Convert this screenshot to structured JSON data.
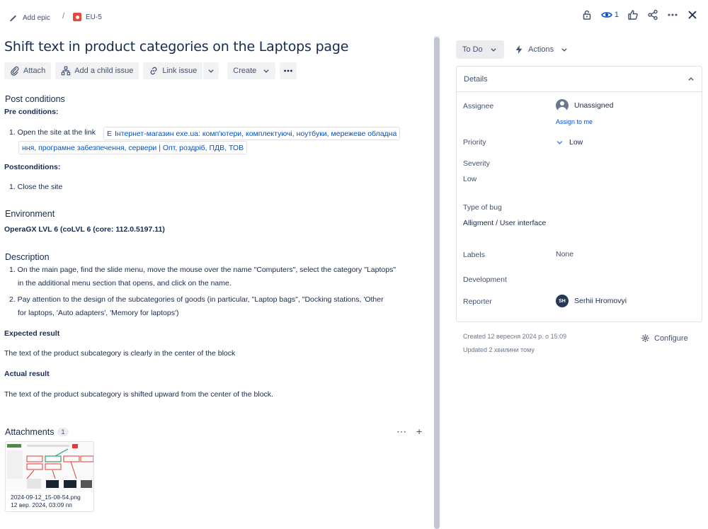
{
  "breadcrumb": {
    "epic_label": "Add epic",
    "separator": "/",
    "issue_key": "EU-5"
  },
  "top_actions": {
    "watch_count": "1"
  },
  "issue": {
    "title": "Shift text in product categories on the Laptops page",
    "toolbar": {
      "attach": "Attach",
      "child": "Add a child issue",
      "link": "Link issue",
      "create": "Create"
    }
  },
  "post_conditions": {
    "heading": "Post conditions",
    "pre_label": "Pre conditions:",
    "pre_item_prefix": "1. Open the site at the link",
    "link_line1": "Інтернет-магазин exe.ua: комп'ютери, комплектуючі, ноутбуки, мережеве обладна",
    "link_line2": "ння, програмне забезпечення, сервери | Опт, роздріб, ПДВ, ТОВ",
    "post_label": "Postconditions:",
    "post_item": "1. Close the site"
  },
  "environment": {
    "heading": "Environment",
    "value": "OperaGX LVL 6 (coLVL 6 (core: 112.0.5197.11)"
  },
  "description": {
    "heading": "Description",
    "step1_a": "1. On the main page, find the slide menu, move the mouse over the name \"Computers\", select the category \"Laptops\"",
    "step1_b": "in the additional menu section that opens, and click on the name.",
    "step2_a": "2. Pay attention to the design of the subcategories of goods (in particular, \"Laptop bags\", \"Docking stations, 'Other",
    "step2_b": "for laptops, 'Auto adapters', 'Memory for laptops')",
    "expected_label": "Expected result",
    "expected_text": "The text of the product subcategory is clearly in the center of the block",
    "actual_label": "Actual result",
    "actual_text": "The text of the product subcategory is shifted upward from the center of the block."
  },
  "attachments": {
    "heading": "Attachments",
    "count": "1",
    "file_name": "2024-09-12_15-08-54.png",
    "file_date": "12 вер. 2024, 03:09 пп"
  },
  "status": {
    "label": "To Do",
    "actions": "Actions"
  },
  "details": {
    "heading": "Details",
    "assignee_label": "Assignee",
    "assignee_value": "Unassigned",
    "assign_to_me": "Assign to me",
    "priority_label": "Priority",
    "priority_value": "Low",
    "severity_label": "Severity",
    "severity_value": "Low",
    "type_label": "Type of bug",
    "type_value": "Alligment / User interface",
    "labels_label": "Labels",
    "labels_value": "None",
    "development_label": "Development",
    "reporter_label": "Reporter",
    "reporter_initials": "SH",
    "reporter_name": "Serhii Hromovyi"
  },
  "meta": {
    "created": "Created 12 вересня 2024 р. о 15:09",
    "updated": "Updated 2 хвилини тому",
    "configure": "Configure"
  }
}
